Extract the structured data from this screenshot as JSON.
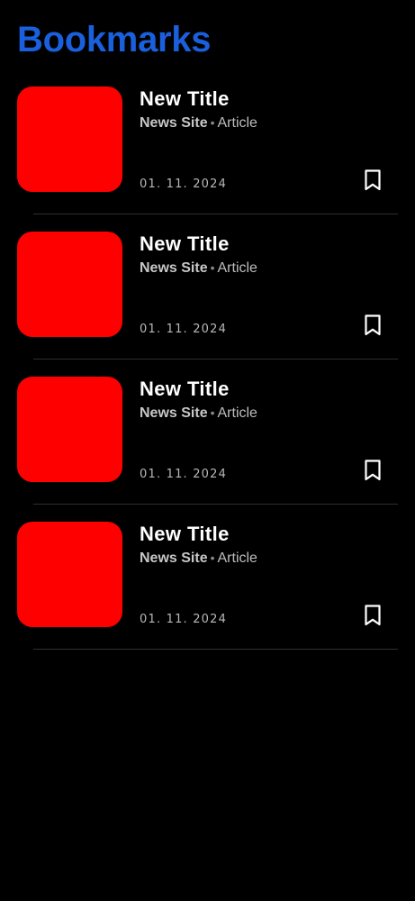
{
  "header": {
    "title": "Bookmarks"
  },
  "colors": {
    "accent": "#1a5fdb",
    "thumbnail": "#ff0000",
    "background": "#000000"
  },
  "bookmarks": [
    {
      "title": "New Title",
      "site": "News Site",
      "separator": "•",
      "type": "Article",
      "date": "01. 11. 2024",
      "icon": "bookmark-outline-icon"
    },
    {
      "title": "New Title",
      "site": "News Site",
      "separator": "•",
      "type": "Article",
      "date": "01. 11. 2024",
      "icon": "bookmark-outline-icon"
    },
    {
      "title": "New Title",
      "site": "News Site",
      "separator": "•",
      "type": "Article",
      "date": "01. 11. 2024",
      "icon": "bookmark-outline-icon"
    },
    {
      "title": "New Title",
      "site": "News Site",
      "separator": "•",
      "type": "Article",
      "date": "01. 11. 2024",
      "icon": "bookmark-outline-icon"
    }
  ]
}
